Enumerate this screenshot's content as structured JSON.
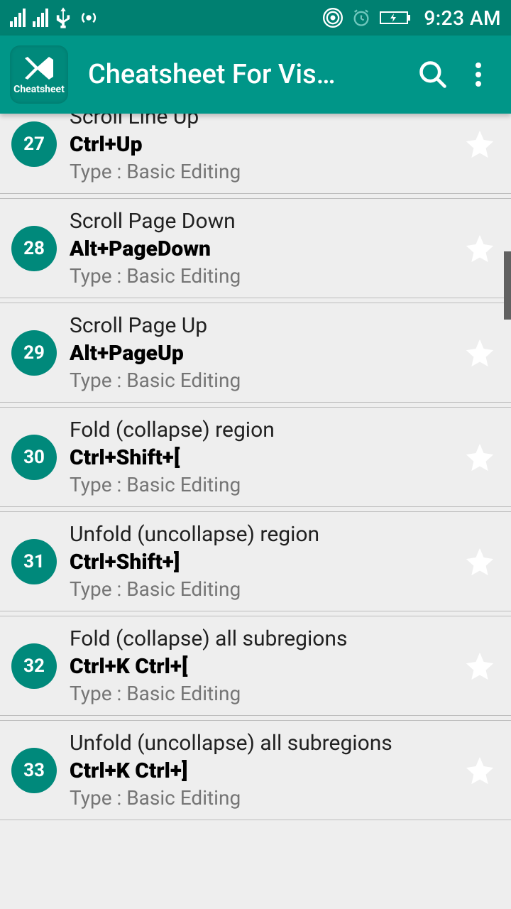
{
  "status": {
    "time": "9:23 AM"
  },
  "appbar": {
    "logo_caption": "Cheatsheet",
    "title": "Cheatsheet For Vis…"
  },
  "type_prefix": "Type : ",
  "items": [
    {
      "num": "",
      "title": "",
      "shortcut": "",
      "type": "Basic Editing"
    },
    {
      "num": "27",
      "title": "Scroll Line Up",
      "shortcut": "Ctrl+Up",
      "type": "Basic Editing"
    },
    {
      "num": "28",
      "title": "Scroll Page Down",
      "shortcut": "Alt+PageDown",
      "type": "Basic Editing"
    },
    {
      "num": "29",
      "title": "Scroll Page Up",
      "shortcut": "Alt+PageUp",
      "type": "Basic Editing"
    },
    {
      "num": "30",
      "title": "Fold (collapse) region",
      "shortcut": "Ctrl+Shift+[",
      "type": "Basic Editing"
    },
    {
      "num": "31",
      "title": "Unfold (uncollapse) region",
      "shortcut": "Ctrl+Shift+]",
      "type": "Basic Editing"
    },
    {
      "num": "32",
      "title": "Fold (collapse) all subregions",
      "shortcut": "Ctrl+K Ctrl+[",
      "type": "Basic Editing"
    },
    {
      "num": "33",
      "title": "Unfold (uncollapse) all subregions",
      "shortcut": "Ctrl+K Ctrl+]",
      "type": "Basic Editing"
    }
  ]
}
